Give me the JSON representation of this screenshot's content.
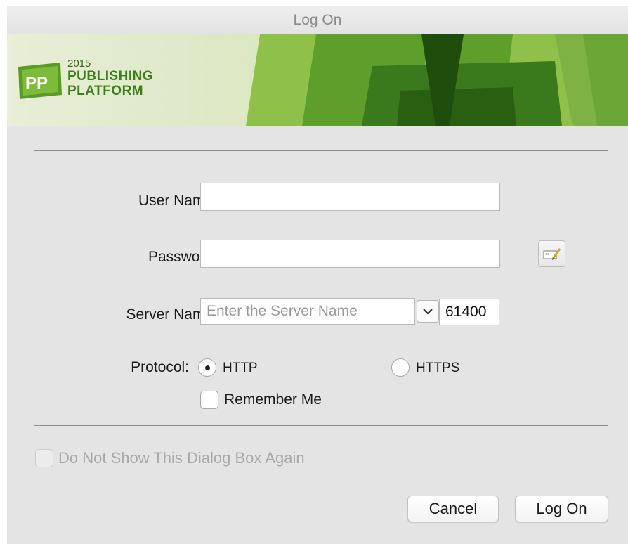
{
  "window": {
    "title": "Log On"
  },
  "branding": {
    "logo_initials": "PP",
    "year": "2015",
    "line1": "PUBLISHING",
    "line2": "PLATFORM",
    "accent_color": "#4f8f2a"
  },
  "form": {
    "username": {
      "label": "User Name:",
      "value": ""
    },
    "password": {
      "label": "Password:",
      "value": "",
      "button_icon": "password-manager-icon"
    },
    "server": {
      "label": "Server Name:",
      "placeholder": "Enter the Server Name",
      "value": "",
      "port_separator": ":",
      "port": "61400"
    },
    "protocol": {
      "label": "Protocol:",
      "options": [
        {
          "label": "HTTP",
          "selected": true
        },
        {
          "label": "HTTPS",
          "selected": false
        }
      ]
    },
    "remember_me": {
      "label": "Remember Me",
      "checked": false
    }
  },
  "dont_show": {
    "label": "Do Not Show This Dialog Box Again",
    "checked": false,
    "enabled": false
  },
  "buttons": {
    "cancel": "Cancel",
    "log_on": "Log On"
  }
}
